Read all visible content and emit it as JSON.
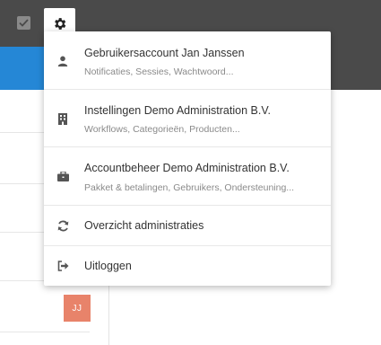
{
  "menu": {
    "items": [
      {
        "title": "Gebruikersaccount Jan Janssen",
        "subtitle": "Notificaties, Sessies, Wachtwoord...",
        "icon": "user-icon"
      },
      {
        "title": "Instellingen Demo Administration B.V.",
        "subtitle": "Workflows, Categorieën, Producten...",
        "icon": "building-icon"
      },
      {
        "title": "Accountbeheer Demo Administration B.V.",
        "subtitle": "Pakket & betalingen, Gebruikers, Ondersteuning...",
        "icon": "briefcase-icon"
      },
      {
        "title": "Overzicht administraties",
        "icon": "refresh-icon"
      },
      {
        "title": "Uitloggen",
        "icon": "logout-icon"
      }
    ]
  },
  "avatar": {
    "initials": "JJ",
    "color": "#e8836a"
  },
  "colors": {
    "topbar": "#4a4a4a",
    "accent": "#2587d6"
  }
}
